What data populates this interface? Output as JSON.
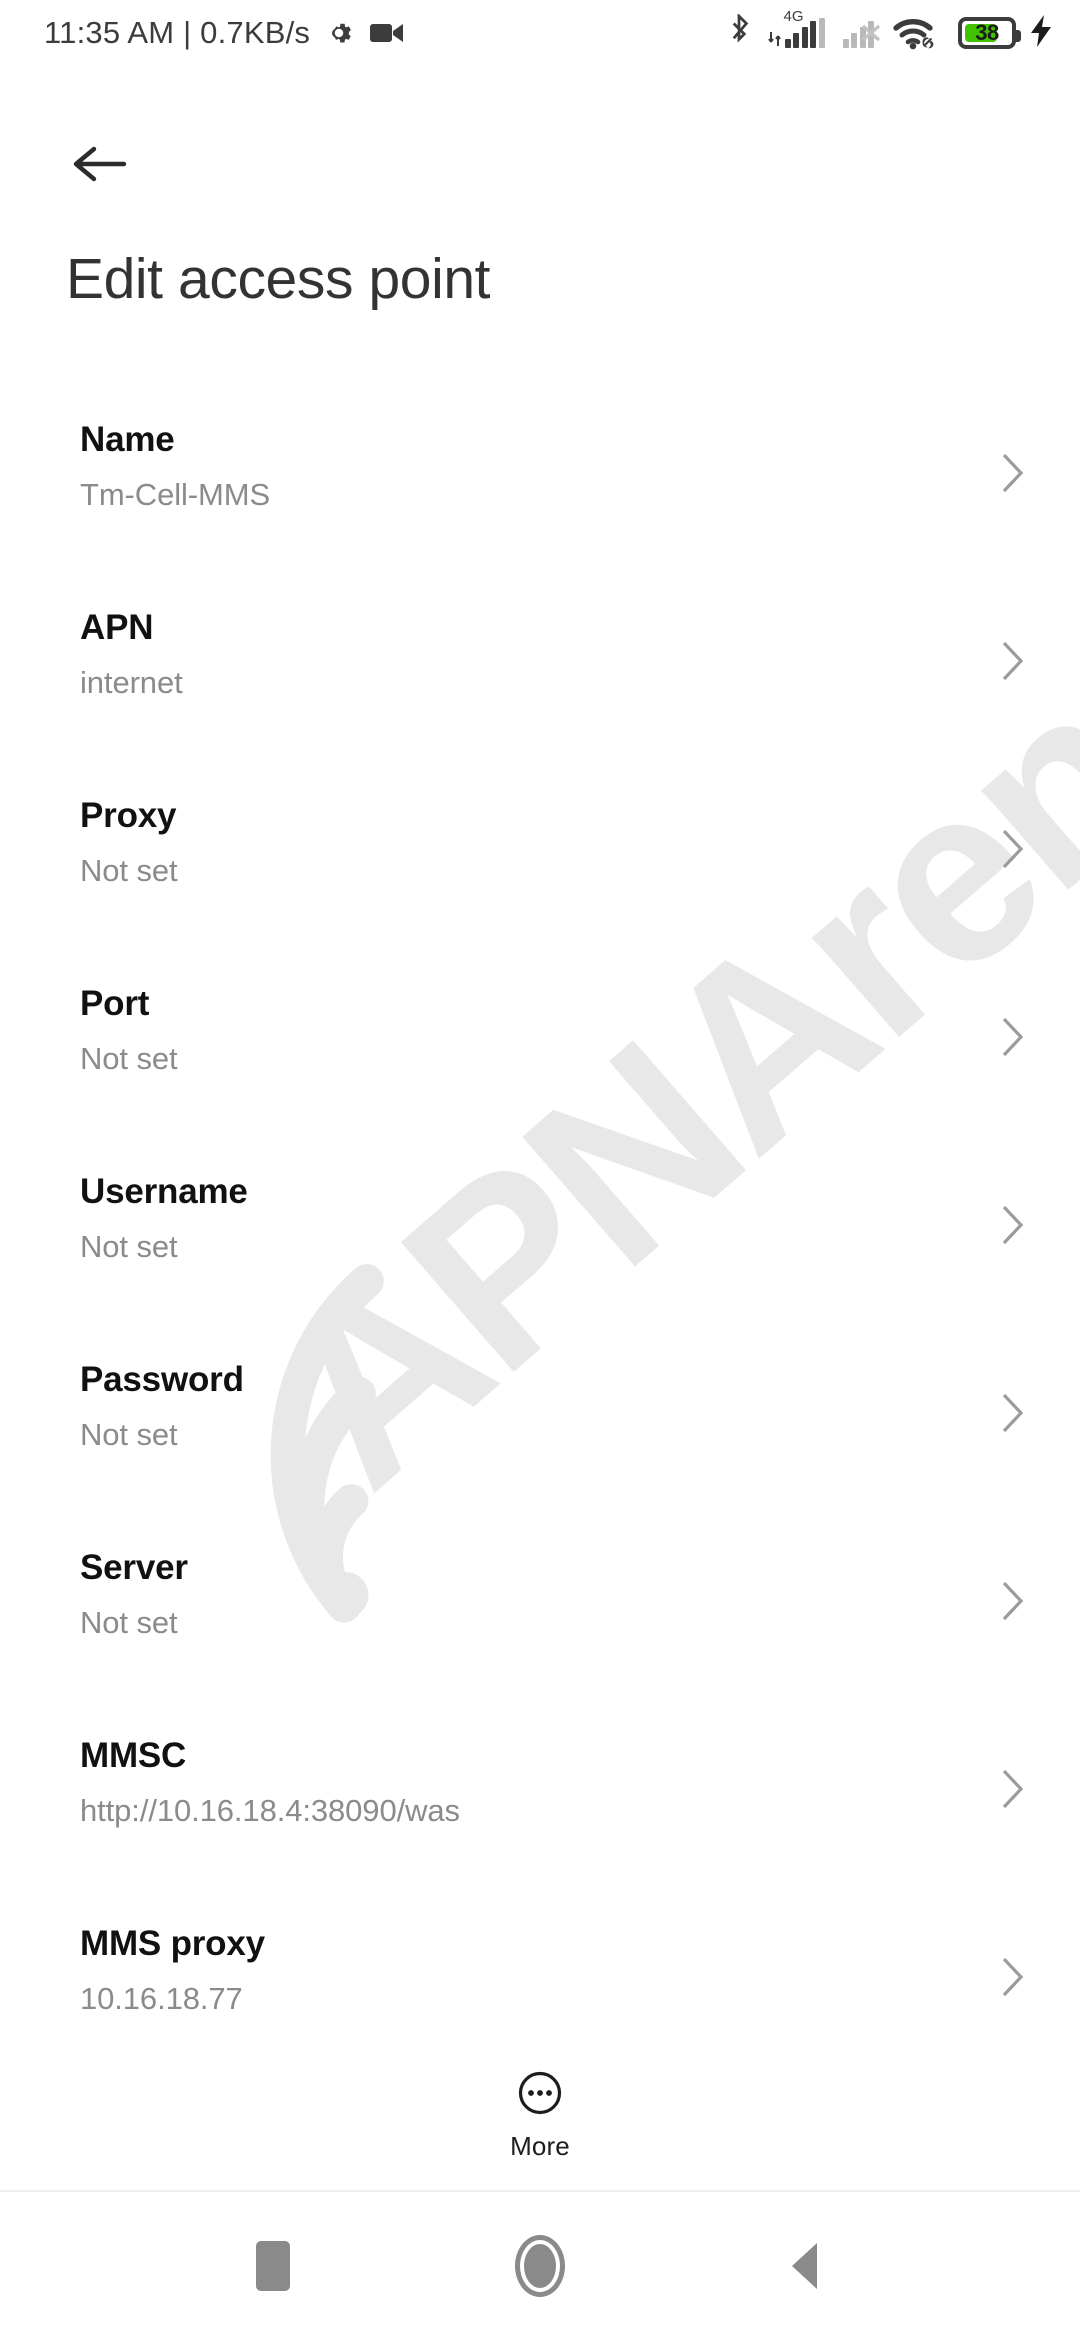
{
  "status_bar": {
    "clock": "11:35 AM | 0.7KB/s",
    "gear_icon": "gear-icon",
    "camera_icon": "video-camera-icon",
    "bluetooth_icon": "bluetooth-icon",
    "network_label": "4G",
    "sim1_bars_filled": 4,
    "sim1_bars_total": 5,
    "sim2_bars_filled": 2,
    "sim2_bars_total": 4,
    "sim2_state": "no-service",
    "wifi_icon": "wifi-icon",
    "wifi_link_icon": "link-icon",
    "battery_percent": "38",
    "battery_level": 38,
    "battery_color": "#41c300",
    "charging_icon": "charging-bolt-icon"
  },
  "header": {
    "back_icon": "arrow-left-icon",
    "title": "Edit access point"
  },
  "watermark": {
    "text": "APNArena",
    "icon": "wifi-signal-icon",
    "color": "#e8e8e8",
    "rotation_deg": -41
  },
  "list": {
    "chevron_icon": "chevron-right-icon",
    "rows": [
      {
        "title": "Name",
        "value": "Tm-Cell-MMS"
      },
      {
        "title": "APN",
        "value": "internet"
      },
      {
        "title": "Proxy",
        "value": "Not set"
      },
      {
        "title": "Port",
        "value": "Not set"
      },
      {
        "title": "Username",
        "value": "Not set"
      },
      {
        "title": "Password",
        "value": "Not set"
      },
      {
        "title": "Server",
        "value": "Not set"
      },
      {
        "title": "MMSC",
        "value": "http://10.16.18.4:38090/was"
      },
      {
        "title": "MMS proxy",
        "value": "10.16.18.77"
      }
    ]
  },
  "more_bar": {
    "label": "More",
    "icon": "more-circle-icon"
  },
  "nav_bar": {
    "recents_icon": "square-recents-icon",
    "home_icon": "circle-home-icon",
    "back_icon": "triangle-back-icon"
  }
}
